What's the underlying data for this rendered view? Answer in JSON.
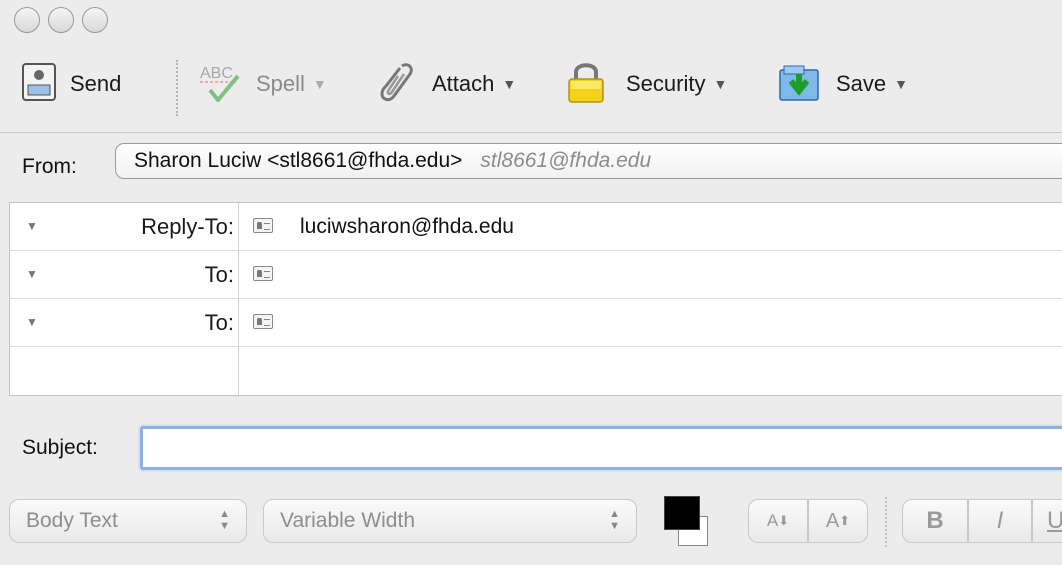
{
  "toolbar": {
    "send_label": "Send",
    "spell_label": "Spell",
    "attach_label": "Attach",
    "security_label": "Security",
    "save_label": "Save"
  },
  "from": {
    "label": "From:",
    "value": "Sharon Luciw <stl8661@fhda.edu>",
    "secondary": "stl8661@fhda.edu"
  },
  "addresses": [
    {
      "label": "Reply-To:",
      "value": "luciwsharon@fhda.edu"
    },
    {
      "label": "To:",
      "value": ""
    },
    {
      "label": "To:",
      "value": ""
    }
  ],
  "subject": {
    "label": "Subject:",
    "value": ""
  },
  "format": {
    "paragraph_style": "Body Text",
    "font": "Variable Width",
    "smaller_text": "A",
    "larger_text": "A",
    "bold": "B",
    "italic": "I",
    "underline": "U"
  },
  "colors": {
    "text_color": "#000000",
    "background_color": "#ffffff",
    "focus_ring": "#8fb3e0"
  }
}
